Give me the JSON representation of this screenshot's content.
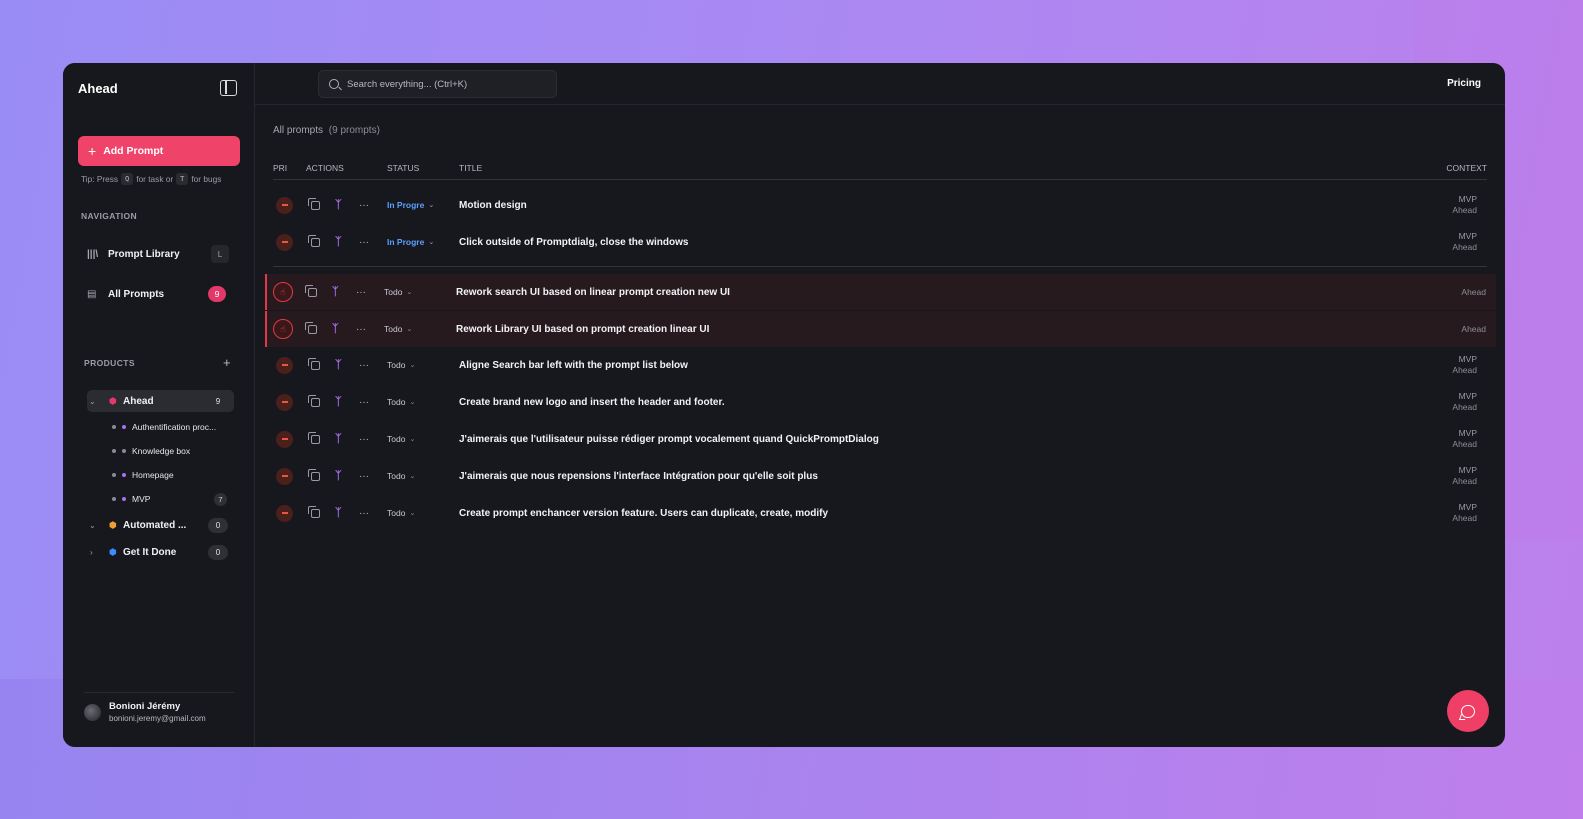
{
  "app": {
    "brand": "Ahead"
  },
  "sidebar": {
    "add_button": "Add Prompt",
    "tip": {
      "prefix": "Tip: Press",
      "key_task": "Q",
      "mid": "for task or",
      "key_bug": "T",
      "suffix": "for bugs"
    },
    "navigation_label": "NAVIGATION",
    "nav_items": [
      {
        "label": "Prompt Library",
        "shortcut": "L",
        "icon": "library-icon"
      },
      {
        "label": "All Prompts",
        "badge": "9",
        "icon": "document-icon"
      }
    ],
    "products_label": "PRODUCTS",
    "products_add": "+",
    "products": [
      {
        "name": "Ahead",
        "count": "9",
        "expanded": true,
        "color": "#e2386a",
        "children": [
          {
            "name": "Authentification proc...",
            "color": "#a86ef2"
          },
          {
            "name": "Knowledge box",
            "color": "#8a8a96"
          },
          {
            "name": "Homepage",
            "color": "#a86ef2"
          },
          {
            "name": "MVP",
            "color": "#a86ef2",
            "count": "7"
          }
        ]
      },
      {
        "name": "Automated ...",
        "count": "0",
        "expanded": true,
        "color": "#f0a030"
      },
      {
        "name": "Get It Done",
        "count": "0",
        "expanded": false,
        "color": "#3a8cff"
      }
    ],
    "user": {
      "name": "Bonioni Jérémy",
      "email": "bonioni.jeremy@gmail.com"
    }
  },
  "topbar": {
    "search_placeholder": "Search everything... (Ctrl+K)",
    "pricing": "Pricing"
  },
  "list": {
    "title": "All prompts",
    "count_label": "(9 prompts)",
    "columns": {
      "pri": "PRI",
      "actions": "ACTIONS",
      "status": "STATUS",
      "title": "TITLE",
      "context": "CONTEXT"
    },
    "rows": [
      {
        "status": "In Progre",
        "title": "Motion design",
        "ctx1": "MVP",
        "ctx2": "Ahead",
        "priority": "medium"
      },
      {
        "status": "In Progre",
        "title": "Click outside of Promptdialg, close the windows",
        "ctx1": "MVP",
        "ctx2": "Ahead",
        "priority": "medium"
      },
      {
        "status": "Todo",
        "title": "Rework search UI based on linear prompt creation new UI",
        "ctx1": "",
        "ctx2": "Ahead",
        "priority": "urgent"
      },
      {
        "status": "Todo",
        "title": "Rework Library UI based on prompt creation linear UI",
        "ctx1": "",
        "ctx2": "Ahead",
        "priority": "urgent"
      },
      {
        "status": "Todo",
        "title": "Aligne Search bar left with the prompt list below",
        "ctx1": "MVP",
        "ctx2": "Ahead",
        "priority": "medium"
      },
      {
        "status": "Todo",
        "title": "Create brand new logo and insert the header and footer.",
        "ctx1": "MVP",
        "ctx2": "Ahead",
        "priority": "medium"
      },
      {
        "status": "Todo",
        "title": "J'aimerais que l'utilisateur puisse rédiger prompt vocalement quand QuickPromptDialog",
        "ctx1": "MVP",
        "ctx2": "Ahead",
        "priority": "medium"
      },
      {
        "status": "Todo",
        "title": "J'aimerais que nous repensions l'interface Intégration pour qu'elle soit plus",
        "ctx1": "MVP",
        "ctx2": "Ahead",
        "priority": "medium"
      },
      {
        "status": "Todo",
        "title": "Create prompt enchancer version feature. Users can duplicate, create, modify",
        "ctx1": "MVP",
        "ctx2": "Ahead",
        "priority": "medium"
      }
    ]
  },
  "colors": {
    "accent": "#f0436a",
    "in_progress": "#5aa0ff",
    "urgent": "#e2394a",
    "action_purple": "#a86ef2"
  }
}
